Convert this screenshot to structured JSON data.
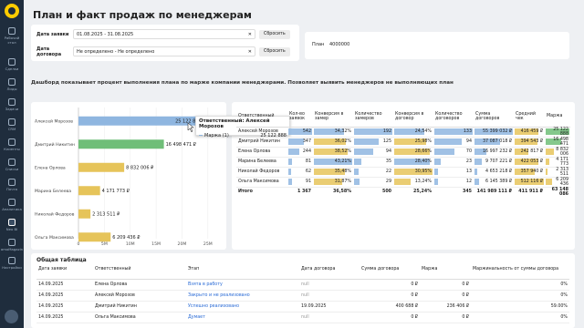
{
  "sidebar": {
    "items": [
      {
        "label": "Рабочий стол",
        "icon": "desktop-icon"
      },
      {
        "label": "Сделки",
        "icon": "deals-icon"
      },
      {
        "label": "Лиды",
        "icon": "leads-icon"
      },
      {
        "label": "Задачи",
        "icon": "tasks-icon"
      },
      {
        "label": "CRM",
        "icon": "crm-icon"
      },
      {
        "label": "Клиенты",
        "icon": "clients-icon"
      },
      {
        "label": "Списки",
        "icon": "lists-icon"
      },
      {
        "label": "Почта",
        "icon": "mail-icon"
      },
      {
        "label": "Аналитика",
        "icon": "analytics-icon"
      },
      {
        "label": "Neo BI",
        "icon": "bi-icon"
      },
      {
        "label": "amoMagazin",
        "icon": "shop-icon"
      },
      {
        "label": "Настройки",
        "icon": "settings-icon"
      }
    ]
  },
  "header": {
    "title": "План и факт продаж по менеджерам"
  },
  "filters": {
    "date_order": {
      "label": "Дата заявки",
      "value": "01.08.2025 - 31.08.2025",
      "reset": "Сбросить"
    },
    "date_contract": {
      "label": "Дата договора",
      "value": "Не определено - Не определено",
      "reset": "Сбросить"
    },
    "plan": {
      "label": "План",
      "value": "4000000"
    }
  },
  "subtitle": "Дашборд показывает процент выполнения плана по марже компании менеджерами. Позволяет выявить менеджеров не выполняющих план",
  "chart_data": {
    "type": "bar",
    "orientation": "horizontal",
    "categories": [
      "Алексей Морозов",
      "Дмитрий Никитин",
      "Елена Орлова",
      "Марина Белеева",
      "Николай Федоров",
      "Ольга Максимова"
    ],
    "values": [
      25122888,
      16498471,
      8832006,
      4171773,
      2313511,
      6209436
    ],
    "value_labels": [
      "25 122 888 ₽",
      "16 498 471 ₽",
      "8 832 006 ₽",
      "4 171 773 ₽",
      "2 313 511 ₽",
      "6 209 436 ₽"
    ],
    "colors": [
      "#8fb6e0",
      "#6fbe78",
      "#e6c45a",
      "#e6c45a",
      "#e6c45a",
      "#e6c45a"
    ],
    "xticks": [
      "0",
      "5M",
      "10M",
      "15M",
      "20M",
      "25M"
    ],
    "xlim": [
      0,
      27500000
    ],
    "tooltip": {
      "title": "Ответственный: Алексей Морозов",
      "series": "Маржа (1)",
      "value": "25 122 888"
    }
  },
  "managers_table": {
    "headers": [
      "Ответственный",
      "Кол-во заявок",
      "Конверсия в замер",
      "Количество замеров",
      "Конверсия в договор",
      "Количество договоров",
      "Сумма договоров",
      "Средний чек",
      "Маржа"
    ],
    "rows": [
      [
        "Алексей Морозов",
        "542",
        "34,32%",
        "192",
        "24,54%",
        "133",
        "55 399 032 ₽",
        "416 459 ₽",
        "25 122 888"
      ],
      [
        "Дмитрий Никитин",
        "347",
        "36,02%",
        "125",
        "25,98%",
        "94",
        "37 087 018 ₽",
        "394 543 ₽",
        "16 498 471"
      ],
      [
        "Елена Орлова",
        "244",
        "38,52%",
        "94",
        "28,66%",
        "70",
        "16 997 232 ₽",
        "242 817 ₽",
        "8 832 006"
      ],
      [
        "Марина Белеева",
        "81",
        "43,21%",
        "35",
        "28,40%",
        "23",
        "9 707 221 ₽",
        "422 053 ₽",
        "4 171 773"
      ],
      [
        "Николай Федоров",
        "62",
        "35,48%",
        "22",
        "30,95%",
        "13",
        "4 653 218 ₽",
        "357 940 ₽",
        "2 313 511"
      ],
      [
        "Ольга Максимова",
        "91",
        "31,87%",
        "29",
        "13,24%",
        "12",
        "6 145 389 ₽",
        "512 116 ₽",
        "6 209 436"
      ]
    ],
    "total": [
      "Итого",
      "1 367",
      "36,58%",
      "500",
      "25,24%",
      "345",
      "141 989 111 ₽",
      "411 911 ₽",
      "63 148 086"
    ],
    "column_fills": [
      {
        "col": 1,
        "color": "#8fb6e0",
        "fractions": [
          1.0,
          0.64,
          0.45,
          0.15,
          0.11,
          0.17
        ]
      },
      {
        "col": 2,
        "color": "#e6c45a",
        "fractions": [
          0.79,
          0.83,
          0.89,
          1.0,
          0.82,
          0.74
        ]
      },
      {
        "col": 3,
        "color": "#8fb6e0",
        "fractions": [
          1.0,
          0.65,
          0.49,
          0.18,
          0.11,
          0.15
        ]
      },
      {
        "col": 4,
        "color": "#e6c45a",
        "fractions": [
          0.79,
          0.84,
          0.93,
          0.92,
          1.0,
          0.43
        ]
      },
      {
        "col": 5,
        "color": "#8fb6e0",
        "fractions": [
          1.0,
          0.71,
          0.53,
          0.17,
          0.1,
          0.09
        ]
      },
      {
        "col": 6,
        "color": "#8fb6e0",
        "fractions": [
          1.0,
          0.67,
          0.31,
          0.18,
          0.08,
          0.11
        ]
      },
      {
        "col": 7,
        "color": "#e6c45a",
        "fractions": [
          0.81,
          0.77,
          0.47,
          0.82,
          0.7,
          1.0
        ]
      },
      {
        "col": 8,
        "color": "#e6c45a",
        "fractions": [
          1.0,
          0.66,
          0.35,
          0.17,
          0.09,
          0.25
        ]
      }
    ],
    "highlights": [
      {
        "row": 0,
        "col": 2,
        "color": "#8fb6e0"
      },
      {
        "row": 3,
        "col": 2,
        "color": "#8fb6e0"
      },
      {
        "row": 0,
        "col": 4,
        "color": "#8fb6e0"
      },
      {
        "row": 3,
        "col": 4,
        "color": "#8fb6e0"
      },
      {
        "row": 1,
        "col": 6,
        "color": "#8fb6e0"
      },
      {
        "row": 0,
        "col": 8,
        "color": "#6fbe78"
      },
      {
        "row": 1,
        "col": 8,
        "color": "#6fbe78"
      }
    ]
  },
  "common_table": {
    "title": "Общая таблица",
    "headers": [
      "Дата заявки",
      "Ответственный",
      "Этап",
      "Дата договора",
      "Сумма договора",
      "Маржа",
      "Маржинальность от суммы договора"
    ],
    "rows": [
      [
        "14.09.2025",
        "Елена Орлова",
        "Взята в работу",
        "null",
        "0 ₽",
        "0 ₽",
        "0%"
      ],
      [
        "14.09.2025",
        "Алексей Морозов",
        "Закрыто и не реализовано",
        "null",
        "0 ₽",
        "0 ₽",
        "0%"
      ],
      [
        "14.09.2025",
        "Дмитрий Никитин",
        "Успешно реализовано",
        "19.09.2025",
        "400 688 ₽",
        "236 406 ₽",
        "59.00%"
      ],
      [
        "14.09.2025",
        "Ольга Максимова",
        "Думает",
        "null",
        "0 ₽",
        "0 ₽",
        "0%"
      ]
    ]
  }
}
